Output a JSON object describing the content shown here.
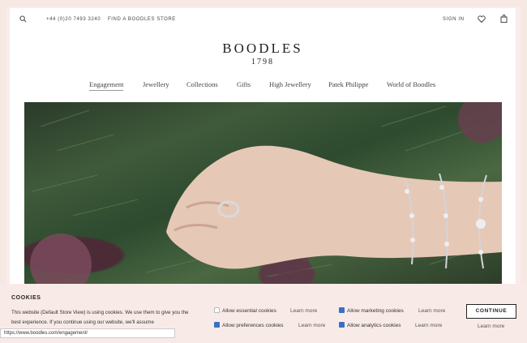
{
  "utility": {
    "phone": "+44 (0)20 7493 3240",
    "store": "FIND A BOODLES STORE",
    "signin": "SIGN IN",
    "icons": [
      "search-icon",
      "heart-icon",
      "bag-icon"
    ]
  },
  "logo": {
    "name": "BOODLES",
    "year": "1798"
  },
  "nav": {
    "items": [
      {
        "label": "Engagement",
        "active": true
      },
      {
        "label": "Jewellery"
      },
      {
        "label": "Collections"
      },
      {
        "label": "Gifts"
      },
      {
        "label": "High Jewellery"
      },
      {
        "label": "Patek Philippe"
      },
      {
        "label": "World of Boodles"
      }
    ]
  },
  "cookie": {
    "title": "COOKIES",
    "description": "This website (Default Store View) is using cookies. We use them to give you the best experience. If you continue using our website, we'll assume",
    "options": [
      {
        "label": "Allow essential cookies",
        "checked": true,
        "disabled": true,
        "learn": "Learn more"
      },
      {
        "label": "Allow marketing cookies",
        "checked": true,
        "learn": "Learn more"
      },
      {
        "label": "Allow preferences cookies",
        "checked": true,
        "learn": "Learn more"
      },
      {
        "label": "Allow analytics cookies",
        "checked": true,
        "learn": "Learn more"
      }
    ],
    "continue": "CONTINUE",
    "continue_learn": "Learn more"
  },
  "status_url": "https://www.boodles.com/engagement/",
  "colors": {
    "checkbox": "#3a6fc8",
    "cookie_bg": "#f8ebe7"
  }
}
